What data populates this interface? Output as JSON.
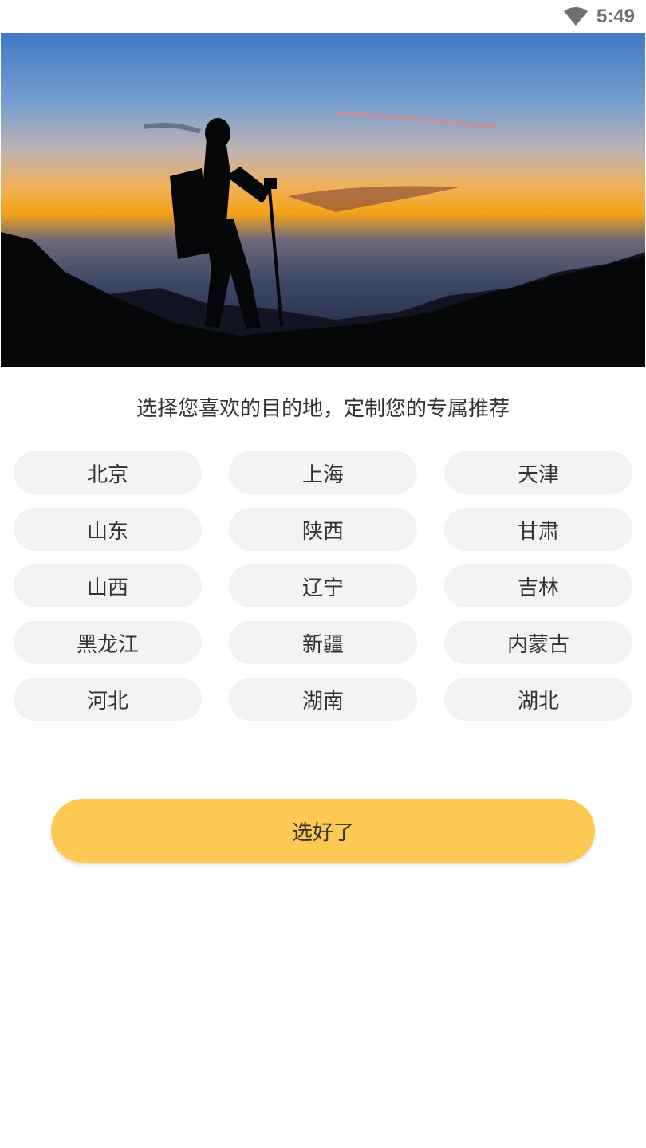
{
  "status_bar": {
    "time": "5:49",
    "wifi_icon": "wifi-icon"
  },
  "hero": {
    "image": "hiker-silhouette-at-sunset"
  },
  "prompt": "选择您喜欢的目的地，定制您的专属推荐",
  "destinations": [
    "北京",
    "上海",
    "天津",
    "山东",
    "陕西",
    "甘肃",
    "山西",
    "辽宁",
    "吉林",
    "黑龙江",
    "新疆",
    "内蒙古",
    "河北",
    "湖南",
    "湖北"
  ],
  "confirm_label": "选好了",
  "colors": {
    "accent": "#fdc952",
    "chip_bg": "#f3f3f3",
    "text": "#333333"
  }
}
